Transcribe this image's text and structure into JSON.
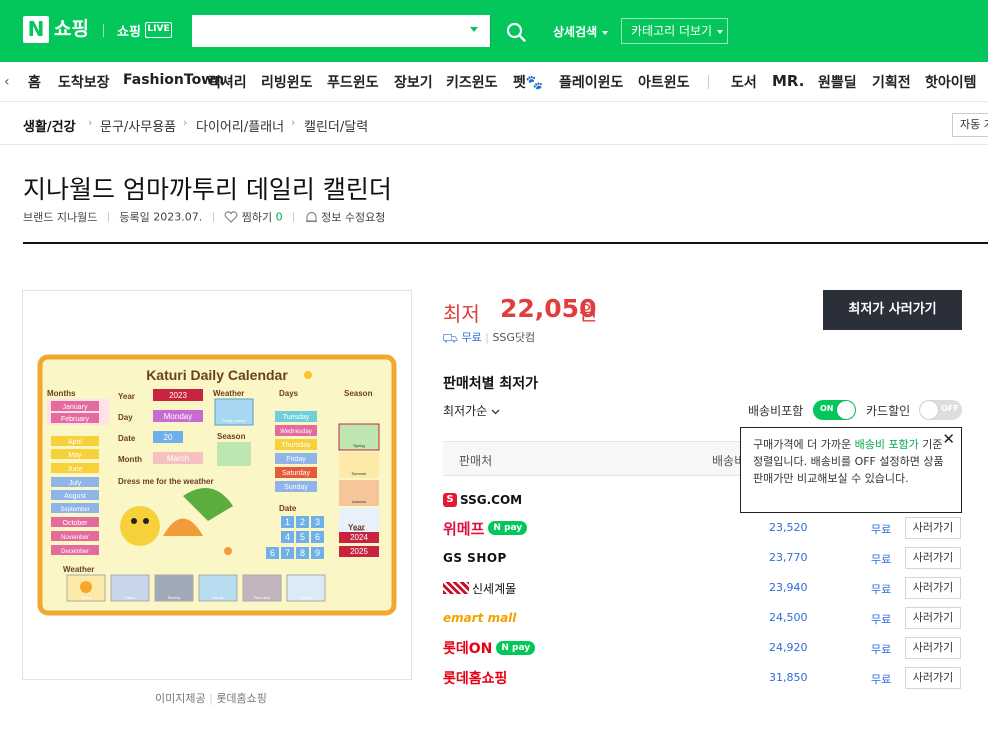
{
  "header": {
    "logo_n": "N",
    "logo_text": "쇼핑",
    "live_text": "쇼핑",
    "live_badge": "LIVE",
    "search_value": "",
    "adv_search": "상세검색",
    "category_more": "카테고리 더보기"
  },
  "nav": {
    "items": [
      "홈",
      "도착보장",
      "FashionTown",
      "럭셔리",
      "리빙윈도",
      "푸드윈도",
      "장보기",
      "키즈윈도",
      "펫🐾",
      "플레이윈도",
      "아트윈도",
      "도서",
      "MR.",
      "원쁠딜",
      "기획전",
      "핫아이템"
    ]
  },
  "breadcrumb": {
    "items": [
      "생활/건강",
      "문구/사무용품",
      "다이어리/플래너",
      "캘린더/달력"
    ],
    "right_button": "자동 가"
  },
  "product": {
    "title": "지나월드 엄마까투리 데일리 캘린더",
    "brand_label": "브랜드",
    "brand": "지나월드",
    "reg_label": "등록일",
    "reg_date": "2023.07.",
    "wish_label": "찜하기",
    "wish_count": "0",
    "edit_request": "정보 수정요청",
    "image_credit_label": "이미지제공",
    "image_credit_seller": "롯데홈쇼핑",
    "image": {
      "title": "Katuri Daily Calendar",
      "months_label": "Months",
      "months": [
        "January",
        "February",
        "April",
        "May",
        "June",
        "July",
        "August",
        "September",
        "October",
        "November",
        "December"
      ],
      "year_label": "Year",
      "year_value": "2023",
      "day_label": "Day",
      "day_value": "Monday",
      "date_label": "Date",
      "date_value": "20",
      "month_label": "Month",
      "month_value": "March",
      "weather_label": "Weather",
      "weather_top": "Partly cloudy",
      "days_label": "Days",
      "days": [
        "Tuesday",
        "Wednesday",
        "Thursday",
        "Friday",
        "Saturday",
        "Sunday"
      ],
      "season_label": "Season",
      "seasons": [
        "Spring",
        "Summer",
        "Autumn",
        "Winter"
      ],
      "dress_label": "Dress me for the weather",
      "date_label2": "Date",
      "date_digits": [
        "1",
        "2",
        "3",
        "4",
        "5",
        "6",
        "7",
        "8",
        "9"
      ],
      "year_label2": "Year",
      "years": [
        "2024",
        "2025"
      ],
      "weather_label2": "Weather",
      "weathers": [
        "Sunny",
        "Rainy",
        "Stormy",
        "Windy",
        "Fine dust",
        "Snowy"
      ]
    }
  },
  "price": {
    "lowest_label": "최저",
    "lowest_value": "22,050",
    "won": "원",
    "shipping": "무료",
    "seller": "SSG닷컴",
    "buy_lowest": "최저가 사러가기"
  },
  "sellers": {
    "heading": "판매처별 최저가",
    "sort": "최저가순",
    "toggle_ship_label": "배송비포함",
    "toggle_ship_state": "ON",
    "toggle_card_label": "카드할인",
    "toggle_card_state": "OFF",
    "col_seller": "판매처",
    "col_ship": "배송비",
    "tooltip_a": "구매가격에 더 가까운 ",
    "tooltip_hl": "배송비 포함가",
    "tooltip_b": "기준 정렬입니다. 배송비를 OFF 설정하면 상품 판매가만 비교해보실 수 있습니다.",
    "npay": "N pay",
    "buy_label": "사러가기",
    "rows": [
      {
        "name": "SSG.COM",
        "price": "",
        "ship": "",
        "npay": false
      },
      {
        "name": "위메프",
        "price": "23,520",
        "ship": "무료",
        "npay": true
      },
      {
        "name": "GS SHOP",
        "price": "23,770",
        "ship": "무료",
        "npay": false
      },
      {
        "name": "신세계몰",
        "price": "23,940",
        "ship": "무료",
        "npay": false
      },
      {
        "name": "emart mall",
        "price": "24,500",
        "ship": "무료",
        "npay": false
      },
      {
        "name": "롯데ON",
        "price": "24,920",
        "ship": "무료",
        "npay": true
      },
      {
        "name": "롯데홈쇼핑",
        "price": "31,850",
        "ship": "무료",
        "npay": false
      }
    ]
  },
  "colors": {
    "brand_green": "#03c75a",
    "price_red": "#e23c3c",
    "link_blue": "#2d6cdf",
    "dark_button": "#2a2f3a"
  }
}
